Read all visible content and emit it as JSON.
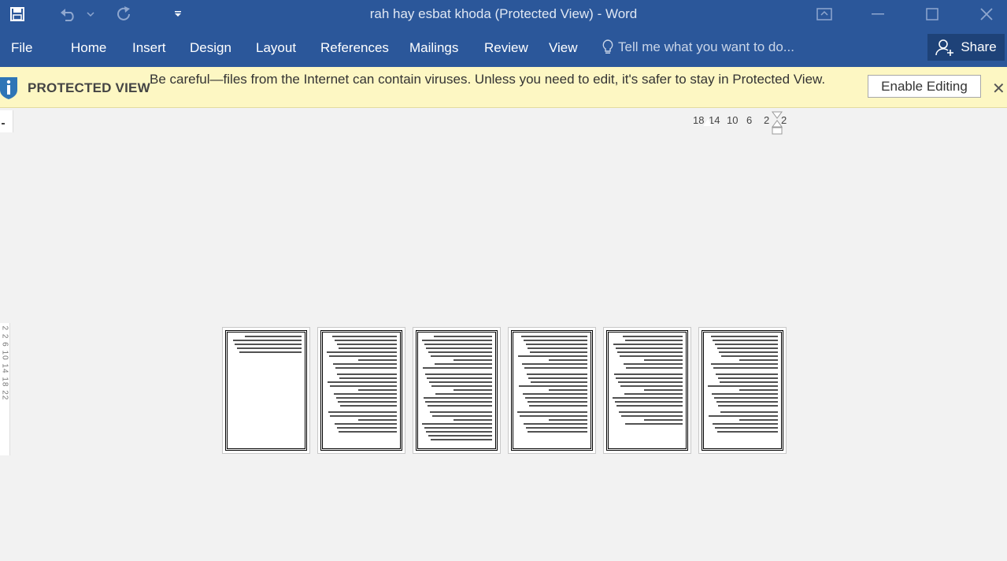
{
  "window": {
    "title": "rah hay esbat khoda (Protected View) - Word"
  },
  "quick_access": {
    "icons": [
      "save-icon",
      "undo-icon",
      "redo-icon",
      "customize-icon"
    ]
  },
  "ribbon": {
    "tabs": [
      "File",
      "Home",
      "Insert",
      "Design",
      "Layout",
      "References",
      "Mailings",
      "Review",
      "View"
    ],
    "tell_me_placeholder": "Tell me what you want to do...",
    "share_label": "Share"
  },
  "protected_view": {
    "label": "PROTECTED VIEW",
    "message": "Be careful—files from the Internet can contain viruses. Unless you need to edit, it's safer to stay in Protected View.",
    "enable_editing_label": "Enable Editing",
    "close_symbol": "✕"
  },
  "ruler": {
    "horizontal_ticks": [
      "18",
      "14",
      "10",
      "6",
      "2",
      "2"
    ],
    "vertical_text": "2 2 6 10 14 18 22"
  },
  "pages": {
    "count": 6
  },
  "colors": {
    "ribbon_blue": "#2b579a",
    "protected_bar": "#fdf7c3"
  }
}
